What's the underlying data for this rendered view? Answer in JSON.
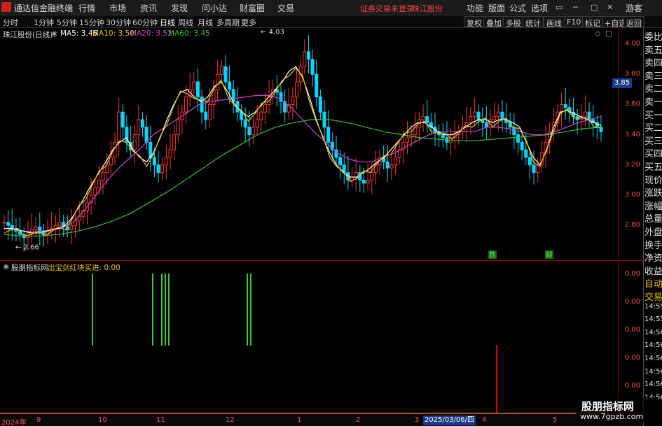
{
  "titlebar": {
    "app_title": "通达信金融终端",
    "menu": [
      "行情",
      "市场",
      "资讯",
      "发现",
      "问小达",
      "财富圈",
      "交易"
    ],
    "notice": "证券交易未登录",
    "stock_name": "珠江股份",
    "right_menu": [
      "功能",
      "版面",
      "公式",
      "选项"
    ],
    "guest": "游客"
  },
  "toolbar": {
    "timeframes": [
      "分时",
      "1分钟",
      "5分钟",
      "15分钟",
      "30分钟",
      "60分钟",
      "日线",
      "周线",
      "月线",
      "多周期",
      "更多"
    ],
    "active_timeframe": "日线",
    "right_buttons": [
      "复权",
      "叠加",
      "多股",
      "统计",
      "画线",
      "F10",
      "标记",
      "+自选",
      "返回"
    ]
  },
  "main_legend": {
    "title": "珠江股份(日线)",
    "ma5": "MA5: 3.46",
    "ma10": "MA10: 3.50",
    "ma20": "MA20: 3.52",
    "ma60": "MA60: 3.45",
    "colors": {
      "ma5": "#ffffff",
      "ma10": "#e8c000",
      "ma20": "#d040d0",
      "ma60": "#30c030",
      "up": "#ff3030",
      "down": "#00d8ff"
    }
  },
  "price_axis": {
    "ticks": [
      "4.00",
      "3.80",
      "3.60",
      "3.40",
      "3.20",
      "3.00",
      "2.80"
    ],
    "current_price": "3.85",
    "high_label": "4.03",
    "low_label": "2.66"
  },
  "markers": [
    "跌",
    "财"
  ],
  "side_panel": {
    "items": [
      "委比",
      "卖五",
      "卖四",
      "卖三",
      "卖二",
      "卖一",
      "买一",
      "买二",
      "买三",
      "买四",
      "买五",
      "现价",
      "涨跌",
      "涨幅",
      "总量",
      "外盘",
      "换手",
      "净资",
      "收益",
      "自动",
      "交易",
      "14:55",
      "14:55",
      "14:56",
      "14:56",
      "14:56",
      "14:56",
      "14:56",
      "14:56"
    ]
  },
  "indicator": {
    "name": "股朋指标网",
    "signal_label": "出宝剑红块买进: 0.00",
    "axis_ticks": [
      "0.00",
      "0.00",
      "0.00",
      "0.00",
      "0.00"
    ]
  },
  "bottom_axis": {
    "labels": [
      "2024年",
      "9",
      "10",
      "11",
      "12",
      "1",
      "2",
      "3",
      "4",
      "5"
    ],
    "crosshair_date": "2025/03/06/四"
  },
  "watermark": {
    "title": "股朋指标网",
    "url": "www.7gpzb.com"
  },
  "chart_data": {
    "type": "candlestick",
    "ylim": [
      2.6,
      4.1
    ],
    "closes": [
      2.82,
      2.8,
      2.78,
      2.76,
      2.74,
      2.72,
      2.75,
      2.77,
      2.79,
      2.76,
      2.74,
      2.76,
      2.78,
      2.8,
      2.82,
      2.79,
      2.77,
      2.8,
      2.83,
      2.86,
      2.9,
      2.95,
      3.0,
      3.05,
      3.1,
      3.15,
      3.2,
      3.25,
      3.35,
      3.55,
      3.45,
      3.35,
      3.3,
      3.4,
      3.5,
      3.45,
      3.35,
      3.25,
      3.2,
      3.15,
      3.2,
      3.25,
      3.3,
      3.4,
      3.5,
      3.55,
      3.65,
      3.7,
      3.75,
      3.65,
      3.55,
      3.5,
      3.6,
      3.7,
      3.8,
      3.85,
      3.75,
      3.7,
      3.62,
      3.55,
      3.5,
      3.45,
      3.4,
      3.45,
      3.5,
      3.55,
      3.6,
      3.65,
      3.7,
      3.68,
      3.62,
      3.55,
      3.6,
      3.65,
      3.75,
      3.85,
      3.95,
      3.9,
      3.8,
      3.65,
      3.55,
      3.45,
      3.35,
      3.3,
      3.25,
      3.2,
      3.15,
      3.1,
      3.12,
      3.15,
      3.1,
      3.08,
      3.1,
      3.15,
      3.2,
      3.25,
      3.22,
      3.18,
      3.2,
      3.25,
      3.3,
      3.35,
      3.38,
      3.4,
      3.45,
      3.5,
      3.52,
      3.48,
      3.45,
      3.42,
      3.4,
      3.38,
      3.35,
      3.38,
      3.4,
      3.42,
      3.45,
      3.48,
      3.52,
      3.55,
      3.5,
      3.48,
      3.45,
      3.5,
      3.52,
      3.55,
      3.5,
      3.48,
      3.45,
      3.4,
      3.35,
      3.3,
      3.25,
      3.2,
      3.15,
      3.2,
      3.28,
      3.35,
      3.42,
      3.48,
      3.55,
      3.6,
      3.58,
      3.55,
      3.52,
      3.5,
      3.52,
      3.55,
      3.5,
      3.48,
      3.45,
      3.42
    ],
    "ma5": [
      2.78,
      2.78,
      2.77,
      2.76,
      2.75,
      2.75,
      2.76,
      2.77,
      2.78,
      2.8,
      2.85,
      2.92,
      3.0,
      3.08,
      3.15,
      3.22,
      3.3,
      3.35,
      3.38,
      3.3,
      3.25,
      3.22,
      3.28,
      3.38,
      3.5,
      3.6,
      3.68,
      3.7,
      3.65,
      3.62,
      3.65,
      3.72,
      3.75,
      3.68,
      3.6,
      3.55,
      3.52,
      3.55,
      3.6,
      3.65,
      3.7,
      3.75,
      3.82,
      3.85,
      3.78,
      3.65,
      3.5,
      3.38,
      3.28,
      3.2,
      3.15,
      3.12,
      3.12,
      3.15,
      3.18,
      3.22,
      3.25,
      3.3,
      3.35,
      3.4,
      3.45,
      3.48,
      3.48,
      3.45,
      3.42,
      3.4,
      3.4,
      3.42,
      3.45,
      3.48,
      3.5,
      3.5,
      3.48,
      3.5,
      3.5,
      3.48,
      3.45,
      3.35,
      3.25,
      3.2,
      3.3,
      3.45,
      3.55,
      3.56,
      3.54,
      3.52,
      3.5,
      3.48,
      3.46
    ],
    "ma20": [
      2.78,
      2.77,
      2.76,
      2.76,
      2.77,
      2.78,
      2.82,
      2.9,
      3.0,
      3.1,
      3.18,
      3.25,
      3.32,
      3.4,
      3.45,
      3.5,
      3.55,
      3.6,
      3.62,
      3.63,
      3.64,
      3.65,
      3.66,
      3.66,
      3.64,
      3.58,
      3.5,
      3.42,
      3.35,
      3.28,
      3.24,
      3.22,
      3.22,
      3.25,
      3.28,
      3.32,
      3.36,
      3.4,
      3.42,
      3.42,
      3.42,
      3.42,
      3.45,
      3.45,
      3.44,
      3.42,
      3.4,
      3.4,
      3.42,
      3.45,
      3.48,
      3.5,
      3.52
    ],
    "ma60": [
      2.74,
      2.73,
      2.73,
      2.74,
      2.76,
      2.79,
      2.83,
      2.88,
      2.95,
      3.02,
      3.1,
      3.18,
      3.26,
      3.33,
      3.4,
      3.45,
      3.48,
      3.5,
      3.5,
      3.48,
      3.45,
      3.42,
      3.4,
      3.38,
      3.37,
      3.36,
      3.36,
      3.37,
      3.38,
      3.39,
      3.4,
      3.42,
      3.44,
      3.45
    ],
    "signal_days": [
      132,
      218,
      231,
      236,
      241,
      353,
      358
    ],
    "red_signal_day": 709
  }
}
